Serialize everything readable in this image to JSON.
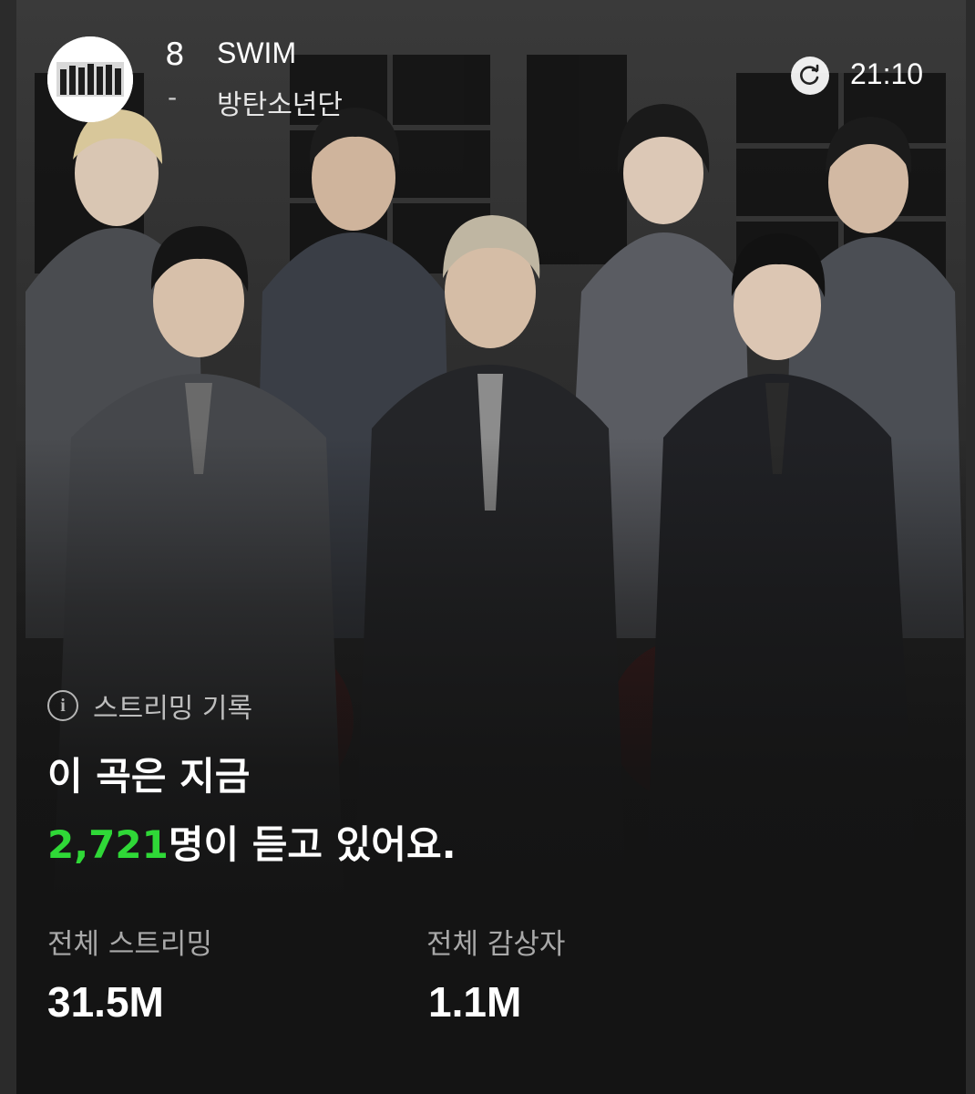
{
  "header": {
    "rank": "8",
    "rank_change": "-",
    "song_title": "SWIM",
    "artist": "방탄소년단",
    "refresh_icon": "refresh-icon",
    "time": "21:10"
  },
  "hero": {
    "image_description_icon": "group-photo"
  },
  "streaming": {
    "section_label": "스트리밍 기록",
    "info_icon": "info-icon",
    "headline_line1": "이 곡은 지금",
    "listeners_now": "2,721",
    "headline_line2_suffix": "명이 듣고 있어요."
  },
  "stats": {
    "total_streams_label": "전체 스트리밍",
    "total_streams_value": "31.5M",
    "total_listeners_label": "전체 감상자",
    "total_listeners_value": "1.1M"
  },
  "colors": {
    "accent_green": "#2fd837",
    "background": "#141414"
  }
}
